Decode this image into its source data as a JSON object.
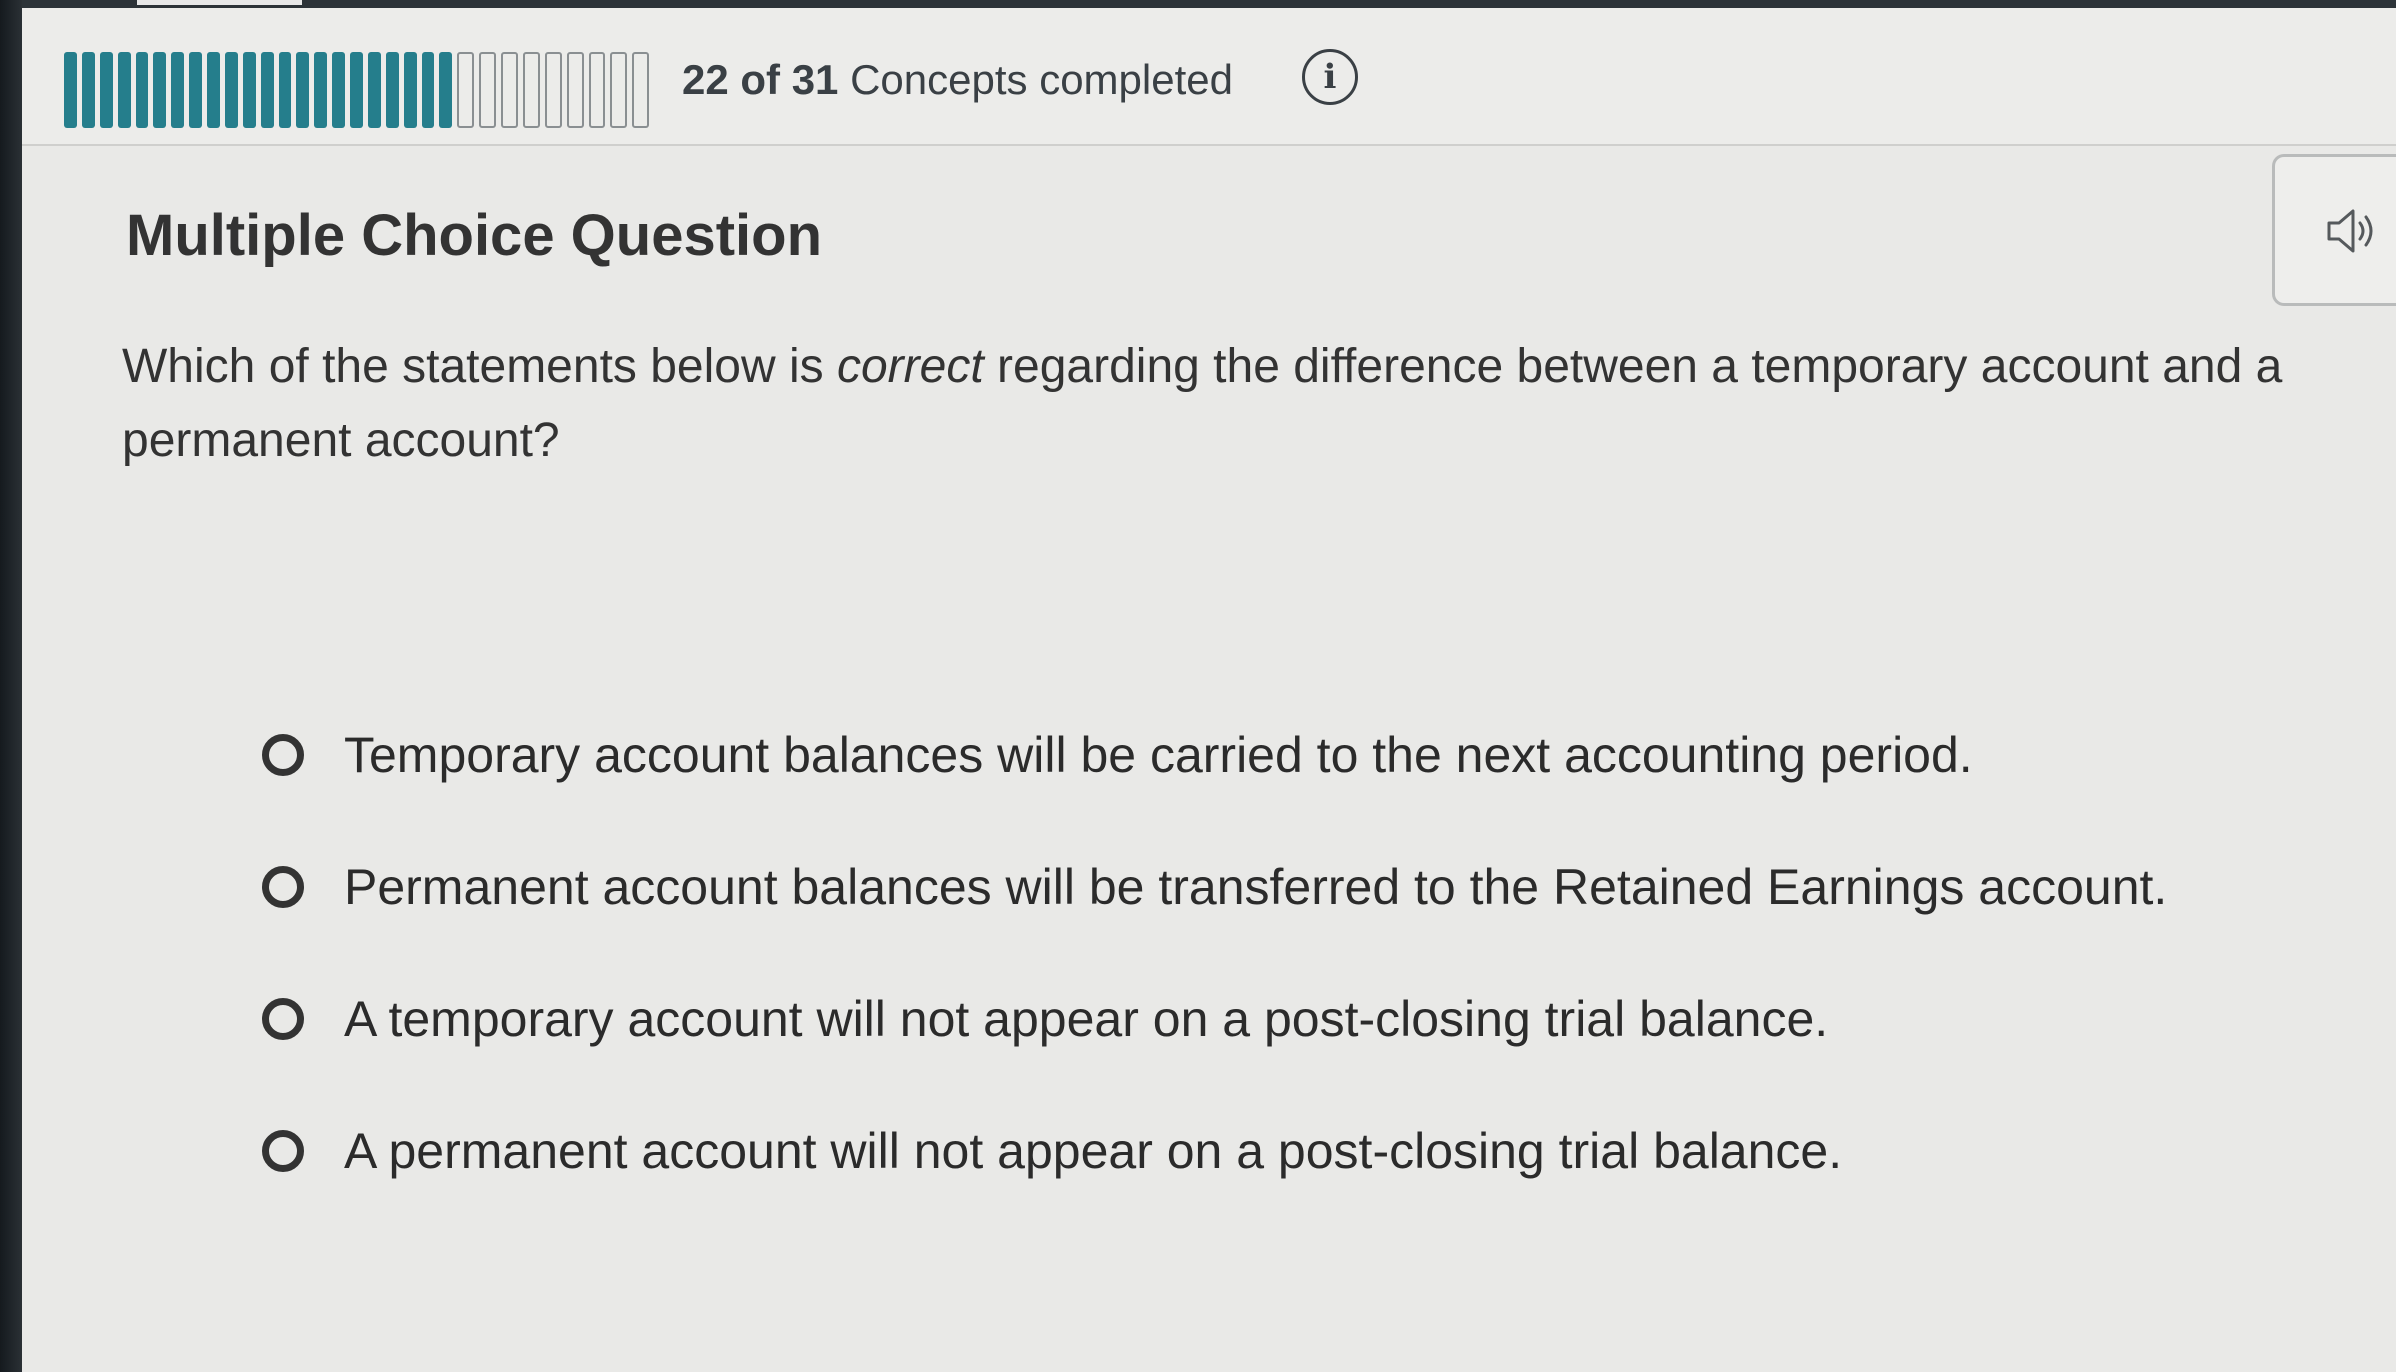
{
  "progress": {
    "completed": 22,
    "total": 31,
    "text_count": "22 of 31",
    "text_suffix": " Concepts completed"
  },
  "icons": {
    "info": "info-icon",
    "audio": "speaker-icon"
  },
  "question": {
    "type_label": "Multiple Choice Question",
    "prompt_before": "Which of the statements below is ",
    "prompt_emphasis": "correct",
    "prompt_after": " regarding the difference between a temporary account and a permanent account?"
  },
  "options": [
    "Temporary account balances will be carried to the next accounting period.",
    "Permanent account balances will be transferred to the Retained Earnings account.",
    "A temporary account will not appear on a post-closing trial balance.",
    "A permanent account will not appear on a post-closing trial balance."
  ],
  "colors": {
    "progress_fill": "#257e8c",
    "text": "#2b2b2b",
    "background": "#e9e9e7"
  }
}
